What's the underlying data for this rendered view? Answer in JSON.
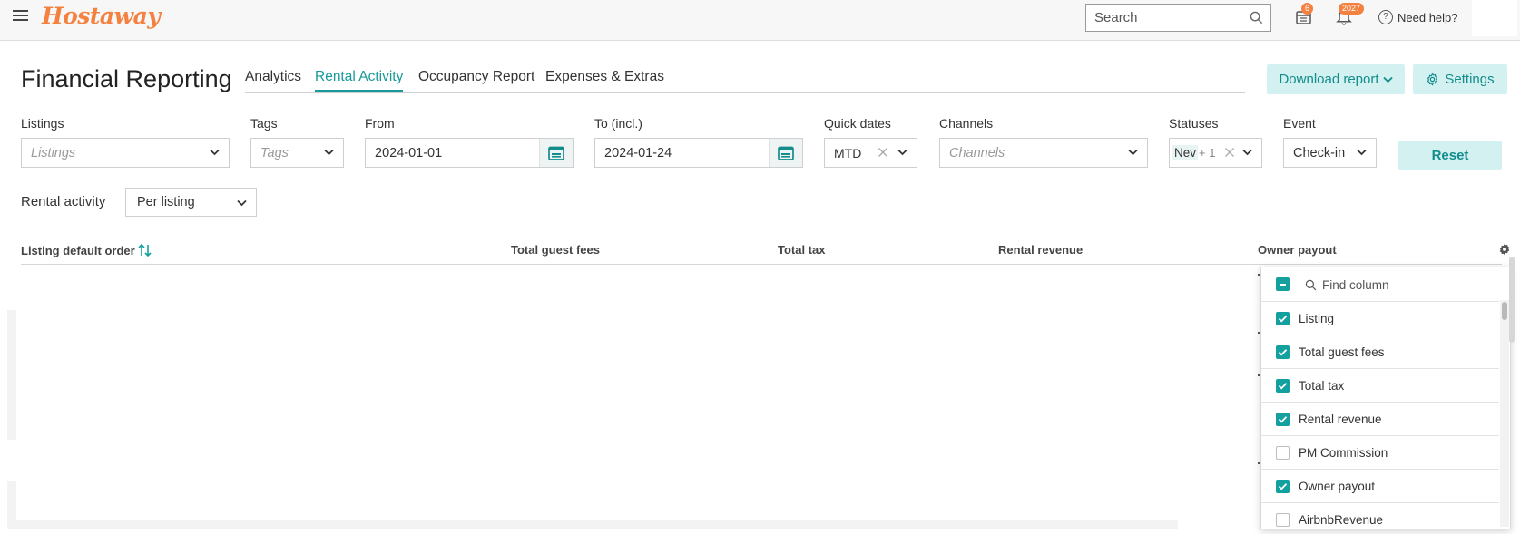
{
  "topbar": {
    "logo": "Hostaway",
    "search_placeholder": "Search",
    "calendar_badge": "6",
    "notifications_badge": "2027",
    "help_label": "Need help?"
  },
  "header": {
    "title": "Financial Reporting",
    "tabs": [
      {
        "label": "Analytics",
        "active": false
      },
      {
        "label": "Rental Activity",
        "active": true
      },
      {
        "label": "Occupancy Report",
        "active": false
      },
      {
        "label": "Expenses & Extras",
        "active": false
      }
    ],
    "download_label": "Download report",
    "settings_label": "Settings"
  },
  "filters": {
    "listings": {
      "label": "Listings",
      "placeholder": "Listings"
    },
    "tags": {
      "label": "Tags",
      "placeholder": "Tags"
    },
    "from": {
      "label": "From",
      "value": "2024-01-01"
    },
    "to": {
      "label": "To (incl.)",
      "value": "2024-01-24"
    },
    "quick_dates": {
      "label": "Quick dates",
      "value": "MTD"
    },
    "channels": {
      "label": "Channels",
      "placeholder": "Channels"
    },
    "statuses": {
      "label": "Statuses",
      "chip": "Nev",
      "more": "+ 1"
    },
    "event": {
      "label": "Event",
      "value": "Check-in"
    },
    "reset_label": "Reset"
  },
  "rental_activity": {
    "label": "Rental activity",
    "value": "Per listing"
  },
  "table": {
    "columns": [
      "Listing default order",
      "Total guest fees",
      "Total tax",
      "Rental revenue",
      "Owner payout"
    ]
  },
  "column_picker": {
    "search_placeholder": "Find column",
    "items": [
      {
        "label": "Listing",
        "checked": true
      },
      {
        "label": "Total guest fees",
        "checked": true
      },
      {
        "label": "Total tax",
        "checked": true
      },
      {
        "label": "Rental revenue",
        "checked": true
      },
      {
        "label": "PM Commission",
        "checked": false
      },
      {
        "label": "Owner payout",
        "checked": true
      },
      {
        "label": "AirbnbRevenue",
        "checked": false
      }
    ]
  },
  "colors": {
    "accent": "#15a0a0",
    "brand": "#f4813f",
    "button_bg": "#d3f1f0"
  }
}
